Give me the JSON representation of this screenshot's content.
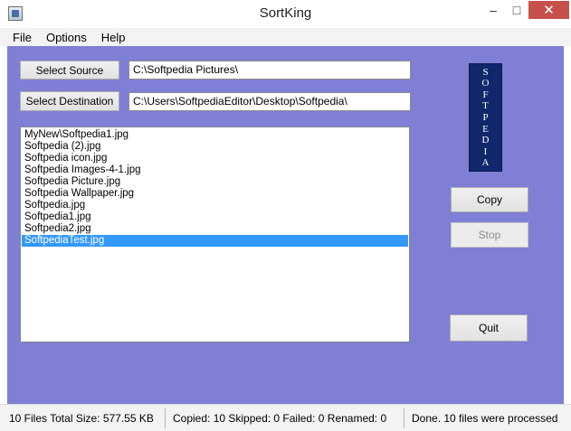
{
  "window": {
    "title": "SortKing"
  },
  "window_controls": {
    "minimize": "–",
    "maximize": "□",
    "close": "✕"
  },
  "menu": {
    "file": "File",
    "options": "Options",
    "help": "Help"
  },
  "source": {
    "button_label": "Select Source",
    "path": "C:\\Softpedia Pictures\\"
  },
  "destination": {
    "button_label": "Select Destination",
    "path": "C:\\Users\\SoftpediaEditor\\Desktop\\Softpedia\\"
  },
  "files": [
    "MyNew\\Softpedia1.jpg",
    "Softpedia (2).jpg",
    "Softpedia icon.jpg",
    "Softpedia Images-4-1.jpg",
    "Softpedia Picture.jpg",
    "Softpedia Wallpaper.jpg",
    "Softpedia.jpg",
    "Softpedia1.jpg",
    "Softpedia2.jpg",
    "SoftpediaTest.jpg"
  ],
  "selected_file_index": 9,
  "banner": {
    "letters": [
      "S",
      "O",
      "F",
      "T",
      "P",
      "E",
      "D",
      "I",
      "A"
    ]
  },
  "buttons": {
    "copy": "Copy",
    "stop": "Stop",
    "quit": "Quit"
  },
  "status": {
    "files": "10 Files  Total Size: 577.55 KB",
    "counts": "Copied: 10  Skipped: 0  Failed: 0  Renamed: 0",
    "message": "Done.  10 files were processed"
  },
  "colors": {
    "panel": "#7f7fd5",
    "selection": "#3399ff",
    "banner": "#10286b",
    "close": "#c7504b"
  }
}
